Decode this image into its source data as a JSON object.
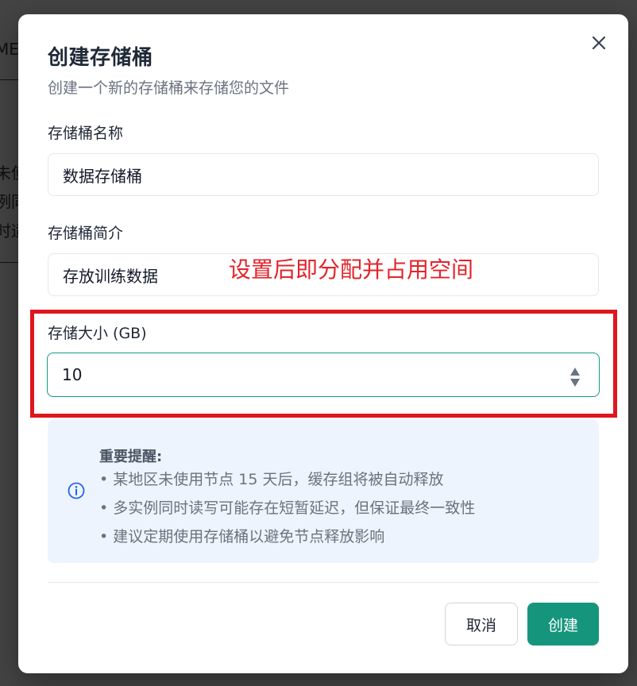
{
  "background": {
    "fragments": [
      "ME",
      "未使",
      "例同",
      "时适"
    ]
  },
  "dialog": {
    "title": "创建存储桶",
    "subtitle": "创建一个新的存储桶来存储您的文件",
    "close_icon": "close-icon"
  },
  "form": {
    "name": {
      "label": "存储桶名称",
      "value": "数据存储桶"
    },
    "description": {
      "label": "存储桶简介",
      "value": "存放训练数据"
    },
    "size": {
      "label": "存储大小 (GB)",
      "value": "10",
      "stepper_icon": "stepper-icon"
    }
  },
  "annotation": {
    "text": "设置后即分配并占用空间",
    "color": "#e3242b"
  },
  "notice": {
    "icon": "info-icon",
    "title": "重要提醒:",
    "items": [
      "某地区未使用节点 15 天后，缓存组将被自动释放",
      "多实例同时读写可能存在短暂延迟，但保证最终一致性",
      "建议定期使用存储桶以避免节点释放影响"
    ]
  },
  "footer": {
    "cancel_label": "取消",
    "create_label": "创建"
  },
  "colors": {
    "primary": "#16957d",
    "focus_border": "#139a82",
    "highlight": "#e0161f",
    "notice_bg": "#eef4fd",
    "info_icon": "#2563eb"
  }
}
